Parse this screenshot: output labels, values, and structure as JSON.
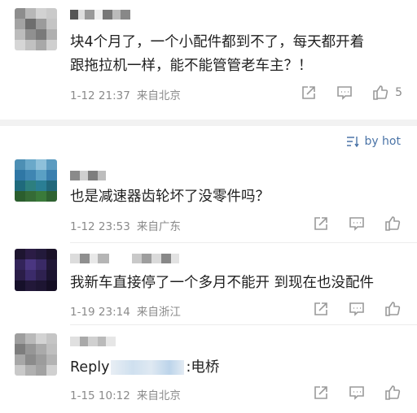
{
  "comments": [
    {
      "text_line1": "块4个月了，一个小配件都到不了，每天都开着",
      "text_line2": "跟拖拉机一样，能不能管管老车主？！",
      "time": "1-12 21:37",
      "location": "来自北京",
      "likes": "5"
    },
    {
      "text_line1": "也是减速器齿轮坏了没零件吗？",
      "time": "1-12 23:53",
      "location": "来自广东"
    },
    {
      "text_line1": "我新车直接停了一个多月不能开 到现在也没配件",
      "time": "1-19 23:14",
      "location": "来自浙江"
    },
    {
      "reply_prefix": "Reply",
      "reply_suffix": ":电桥",
      "time": "1-15 10:12",
      "location": "来自北京"
    }
  ],
  "sort": {
    "label": "by hot"
  },
  "icons": {
    "share": "share-icon",
    "comment": "comment-icon",
    "like": "thumbs-up-icon",
    "sort": "sort-icon"
  },
  "colors": {
    "meta_text": "#8a8a8a",
    "sort_link": "#4b74a7",
    "divider": "#f2f2f2"
  }
}
